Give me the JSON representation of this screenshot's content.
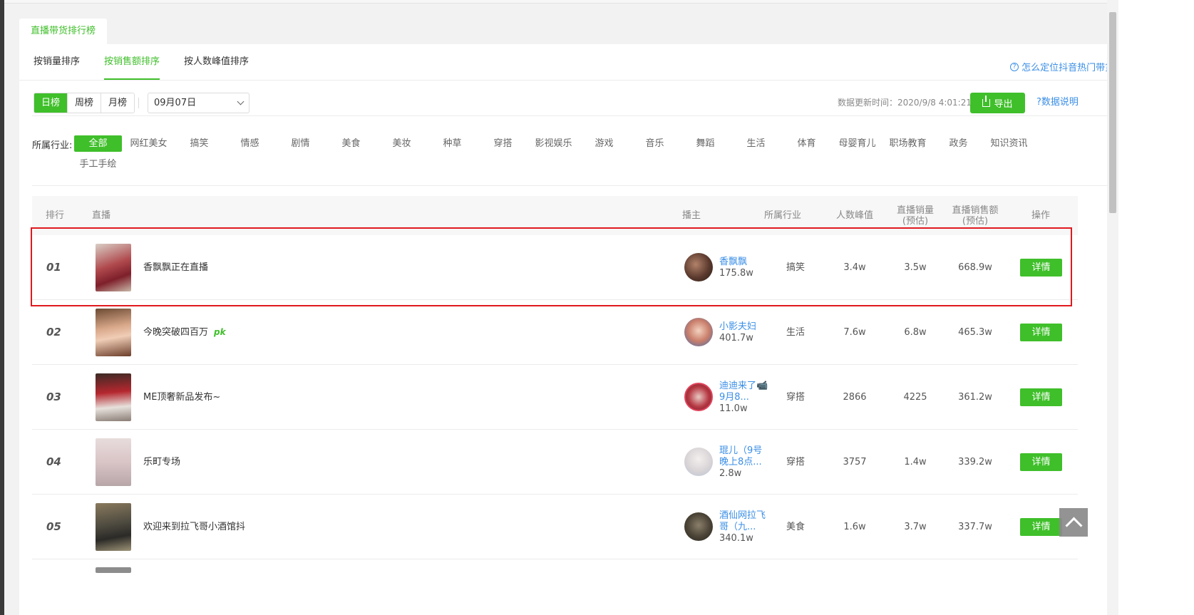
{
  "page": {
    "title_tab": "直播带货排行榜",
    "help_link": "怎么定位抖音热门带货直播间?"
  },
  "sort_tabs": [
    {
      "label": "按销量排序",
      "active": false
    },
    {
      "label": "按销售额排序",
      "active": true
    },
    {
      "label": "按人数峰值排序",
      "active": false
    }
  ],
  "period_tabs": [
    {
      "label": "日榜",
      "active": true
    },
    {
      "label": "周榜",
      "active": false
    },
    {
      "label": "月榜",
      "active": false
    }
  ],
  "date_select": {
    "value": "09月07日"
  },
  "update_time": "数据更新时间：2020/9/8 4:01:21",
  "export_label": "导出",
  "data_help": "?数据说明",
  "industry": {
    "label": "所属行业:",
    "options": [
      "全部",
      "网红美女",
      "搞笑",
      "情感",
      "剧情",
      "美食",
      "美妆",
      "种草",
      "穿搭",
      "影视娱乐",
      "游戏",
      "音乐",
      "舞蹈",
      "生活",
      "体育",
      "母婴育儿",
      "职场教育",
      "政务",
      "知识资讯",
      "手工手绘"
    ],
    "selected": "全部"
  },
  "table": {
    "headers": {
      "rank": "排行",
      "live": "直播",
      "anchor": "播主",
      "industry": "所属行业",
      "peak": "人数峰值",
      "sales_volume": "直播销量(预估)",
      "sales_amount": "直播销售额(预估)",
      "action": "操作"
    },
    "detail_label": "详情",
    "rows": [
      {
        "rank": "01",
        "title": "香飘飘正在直播",
        "pk": "",
        "anchor_name": "香飘飘",
        "anchor_fans": "175.8w",
        "industry": "搞笑",
        "peak": "3.4w",
        "sales_volume": "3.5w",
        "sales_amount": "668.9w"
      },
      {
        "rank": "02",
        "title": "今晚突破四百万",
        "pk": "pk",
        "anchor_name": "小影夫妇",
        "anchor_fans": "401.7w",
        "industry": "生活",
        "peak": "7.6w",
        "sales_volume": "6.8w",
        "sales_amount": "465.3w"
      },
      {
        "rank": "03",
        "title": "ME顶奢新品发布~",
        "pk": "",
        "anchor_name": "迪迪来了📹9月8...",
        "anchor_fans": "11.0w",
        "industry": "穿搭",
        "peak": "2866",
        "sales_volume": "4225",
        "sales_amount": "361.2w"
      },
      {
        "rank": "04",
        "title": "乐町专场",
        "pk": "",
        "anchor_name": "琨儿（9号晚上8点...",
        "anchor_fans": "2.8w",
        "industry": "穿搭",
        "peak": "3757",
        "sales_volume": "1.4w",
        "sales_amount": "339.2w"
      },
      {
        "rank": "05",
        "title": "欢迎来到拉飞哥小酒馆抖",
        "pk": "",
        "anchor_name": "酒仙网拉飞哥（九...",
        "anchor_fans": "340.1w",
        "industry": "美食",
        "peak": "1.6w",
        "sales_volume": "3.7w",
        "sales_amount": "337.7w"
      }
    ]
  },
  "colors": {
    "accent": "#3fbf2a",
    "link": "#3a8ee6",
    "highlight": "#e0191f"
  }
}
